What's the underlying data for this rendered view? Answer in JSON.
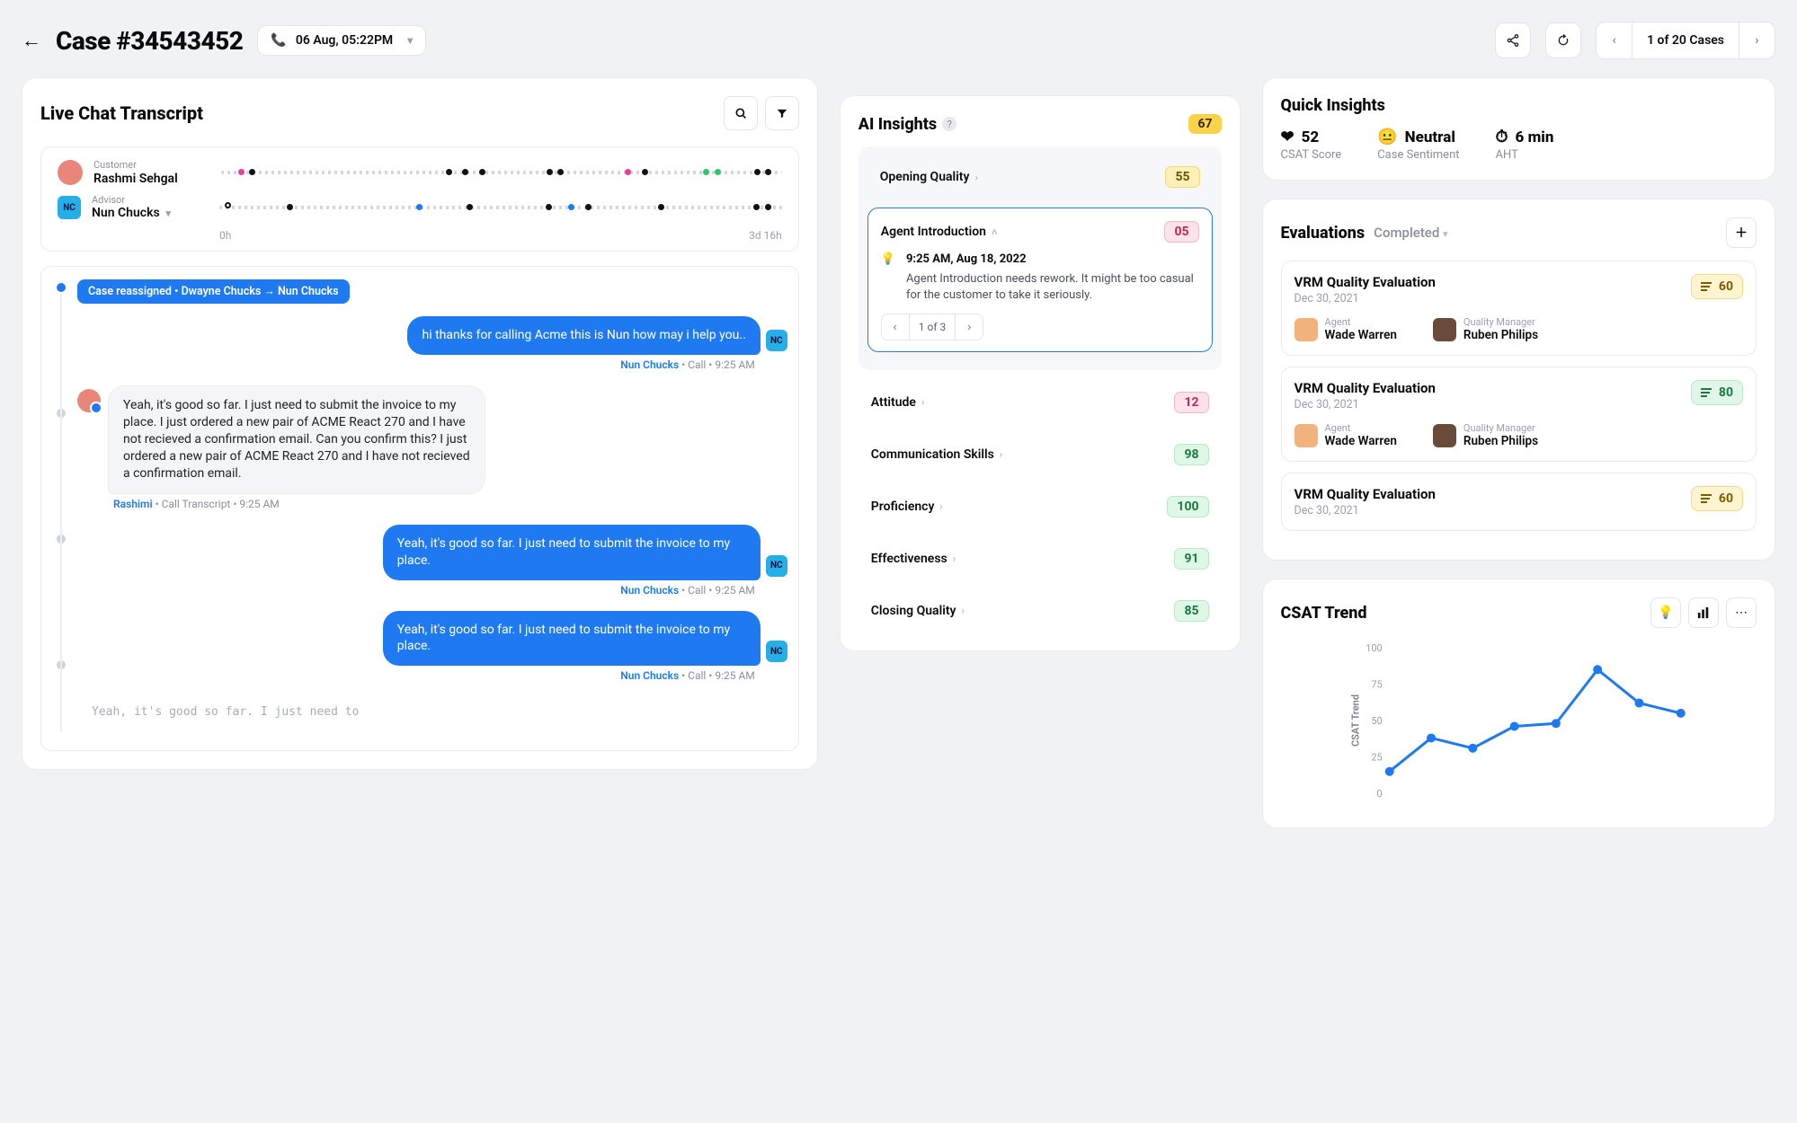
{
  "header": {
    "case_title": "Case #34543452",
    "date_label": "06 Aug, 05:22PM",
    "pager_label": "1 of 20 Cases"
  },
  "transcript": {
    "title": "Live Chat Transcript",
    "timeline": {
      "start_label": "0h",
      "end_label": "3d 16h"
    },
    "customer": {
      "role": "Customer",
      "name": "Rashmi Sehgal"
    },
    "advisor": {
      "role": "Advisor",
      "name": "Nun Chucks",
      "initials": "NC"
    },
    "system_event": "Case reassigned  •  Dwayne Chucks → Nun Chucks",
    "messages": [
      {
        "side": "out",
        "text": "hi thanks for calling Acme this is Nun how may i help you..",
        "who": "Nun Chucks",
        "meta": "Call • 9:25 AM",
        "nc": true
      },
      {
        "side": "in",
        "text": "Yeah, it's good so far. I just need to submit the invoice to my place. I just ordered a new pair of ACME React 270 and I have not recieved a confirmation email. Can you confirm this? I just ordered a new pair of ACME React 270 and I have not recieved a confirmation email.",
        "who": "Rashimi",
        "meta": "Call Transcript • 9:25 AM"
      },
      {
        "side": "out",
        "text": "Yeah, it's good so far. I just need to submit the invoice to my place.",
        "who": "Nun Chucks",
        "meta": "Call • 9:25 AM",
        "nc": true
      },
      {
        "side": "out",
        "text": "Yeah, it's good so far. I just need to submit the invoice to my place.",
        "who": "Nun Chucks",
        "meta": "Call • 9:25 AM",
        "nc": true
      }
    ],
    "tail_text": "Yeah, it's good so far. I just need to"
  },
  "ai_insights": {
    "title": "AI Insights",
    "overall_score": "67",
    "opening": {
      "label": "Opening Quality",
      "score": "55"
    },
    "expanded": {
      "label": "Agent Introduction",
      "score": "05",
      "time": "9:25 AM, Aug 18, 2022",
      "body": "Agent Introduction needs rework. It might be too casual for the customer to take it seriously.",
      "pager": "1 of 3"
    },
    "rows": [
      {
        "label": "Attitude",
        "score": "12",
        "tone": "pink"
      },
      {
        "label": "Communication Skills",
        "score": "98",
        "tone": "green"
      },
      {
        "label": "Proficiency",
        "score": "100",
        "tone": "green"
      },
      {
        "label": "Effectiveness",
        "score": "91",
        "tone": "green"
      },
      {
        "label": "Closing Quality",
        "score": "85",
        "tone": "green"
      }
    ]
  },
  "quick": {
    "title": "Quick Insights",
    "csat": {
      "value": "52",
      "label": "CSAT Score"
    },
    "sentiment": {
      "value": "Neutral",
      "label": "Case Sentiment"
    },
    "aht": {
      "value": "6 min",
      "label": "AHT"
    }
  },
  "evaluations": {
    "title": "Evaluations",
    "state": "Completed",
    "cards": [
      {
        "title": "VRM Quality Evaluation",
        "date": "Dec 30, 2021",
        "score": "60",
        "tone": "amber",
        "agent_role": "Agent",
        "agent_name": "Wade Warren",
        "qm_role": "Quality Manager",
        "qm_name": "Ruben Philips"
      },
      {
        "title": "VRM Quality Evaluation",
        "date": "Dec 30, 2021",
        "score": "80",
        "tone": "green",
        "agent_role": "Agent",
        "agent_name": "Wade Warren",
        "qm_role": "Quality Manager",
        "qm_name": "Ruben Philips"
      },
      {
        "title": "VRM Quality Evaluation",
        "date": "Dec 30, 2021",
        "score": "60",
        "tone": "amber"
      }
    ]
  },
  "trend": {
    "title": "CSAT Trend"
  },
  "chart_data": {
    "type": "line",
    "ylabel": "CSAT Trend",
    "ylim": [
      0,
      100
    ],
    "yticks": [
      0,
      25,
      50,
      75,
      100
    ],
    "values": [
      15,
      38,
      31,
      46,
      48,
      85,
      62,
      55
    ]
  }
}
